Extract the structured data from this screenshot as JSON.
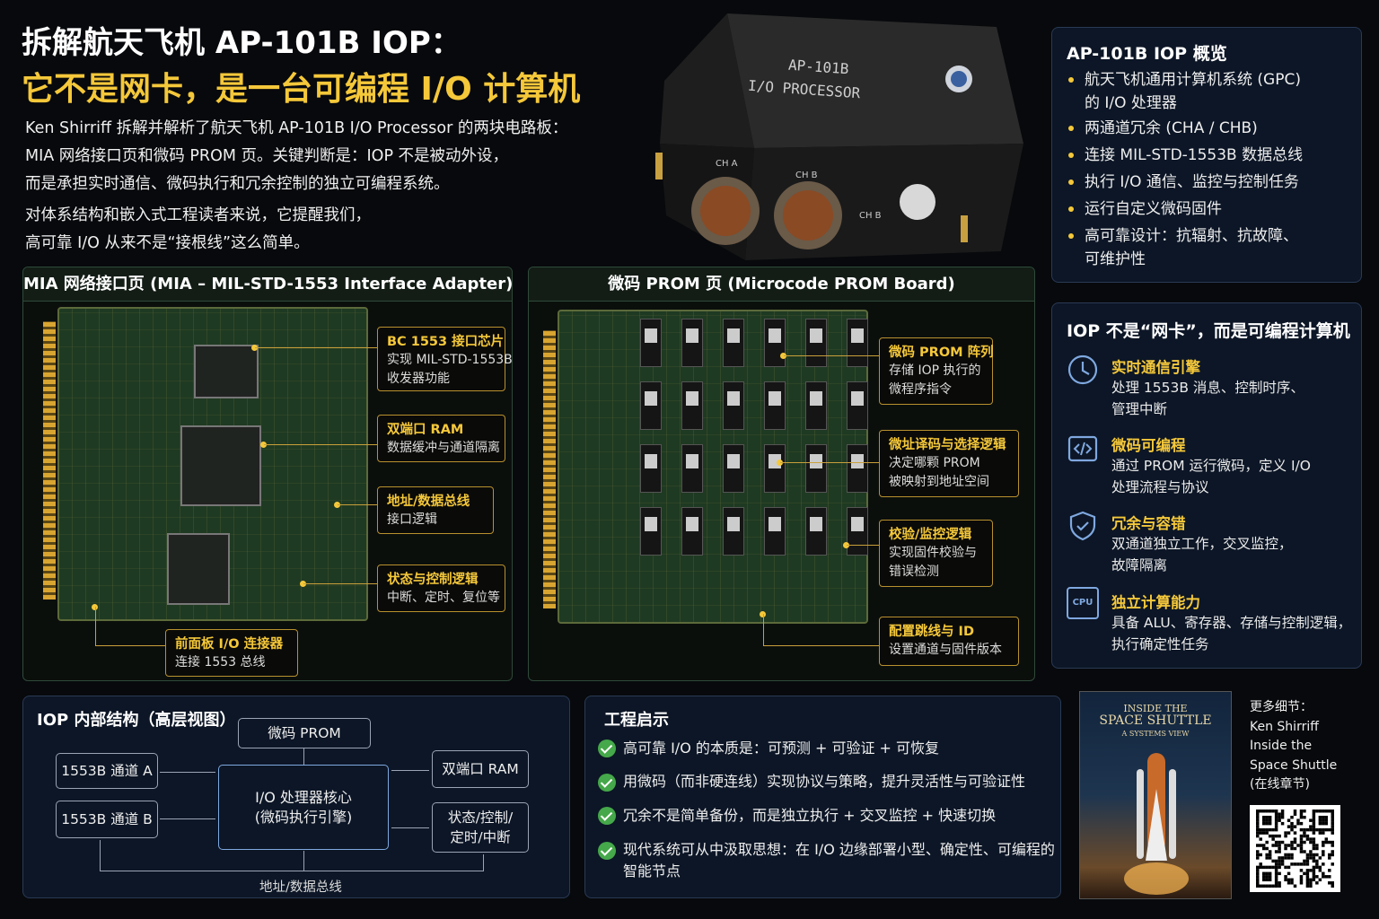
{
  "header": {
    "title_line1": "拆解航天飞机 AP-101B IOP：",
    "title_line2": "它不是网卡，是一台可编程 I/O 计算机",
    "intro": [
      "Ken Shirriff 拆解并解析了航天飞机 AP-101B I/O Processor 的两块电路板：",
      "MIA 网络接口页和微码 PROM 页。关键判断是：IOP 不是被动外设，",
      "而是承担实时通信、微码执行和冗余控制的独立可编程系统。",
      "对体系结构和嵌入式工程读者来说，它提醒我们，",
      "高可靠 I/O 从来不是“接根线”这么简单。"
    ]
  },
  "device": {
    "label_line1": "AP-101B",
    "label_line2": "I/O PROCESSOR",
    "ch_a": "CH A",
    "ch_b": "CH B",
    "ch_b_side": "CH B"
  },
  "overview": {
    "title": "AP-101B IOP 概览",
    "items": [
      [
        "航天飞机通用计算机系统 (GPC)",
        "的 I/O 处理器"
      ],
      [
        "两通道冗余 (CHA / CHB)"
      ],
      [
        "连接 MIL-STD-1553B 数据总线"
      ],
      [
        "执行 I/O 通信、监控与控制任务"
      ],
      [
        "运行自定义微码固件"
      ],
      [
        "高可靠设计：抗辐射、抗故障、",
        "可维护性"
      ]
    ]
  },
  "mia": {
    "title": "MIA 网络接口页 (MIA – MIL-STD-1553 Interface Adapter)",
    "callouts": [
      {
        "title": "BC 1553 接口芯片",
        "desc": [
          "实现 MIL-STD-1553B",
          "收发器功能"
        ]
      },
      {
        "title": "双端口 RAM",
        "desc": [
          "数据缓冲与通道隔离"
        ]
      },
      {
        "title": "地址/数据总线",
        "desc": [
          "接口逻辑"
        ]
      },
      {
        "title": "状态与控制逻辑",
        "desc": [
          "中断、定时、复位等"
        ]
      },
      {
        "title": "前面板 I/O 连接器",
        "desc": [
          "连接 1553 总线"
        ]
      }
    ]
  },
  "prom": {
    "title": "微码 PROM 页 (Microcode PROM Board)",
    "callouts": [
      {
        "title": "微码 PROM 阵列",
        "desc": [
          "存储 IOP 执行的",
          "微程序指令"
        ]
      },
      {
        "title": "微址译码与选择逻辑",
        "desc": [
          "决定哪颗 PROM",
          "被映射到地址空间"
        ]
      },
      {
        "title": "校验/监控逻辑",
        "desc": [
          "实现固件校验与",
          "错误检测"
        ]
      },
      {
        "title": "配置跳线与 ID",
        "desc": [
          "设置通道与固件版本"
        ]
      }
    ]
  },
  "features": {
    "title": "IOP 不是“网卡”，而是可编程计算机",
    "items": [
      {
        "icon": "clock-icon",
        "title": "实时通信引擎",
        "desc": [
          "处理 1553B 消息、控制时序、",
          "管理中断"
        ]
      },
      {
        "icon": "code-icon",
        "title": "微码可编程",
        "desc": [
          "通过 PROM 运行微码，定义 I/O",
          "处理流程与协议"
        ]
      },
      {
        "icon": "shield-icon",
        "title": "冗余与容错",
        "desc": [
          "双通道独立工作，交叉监控，",
          "故障隔离"
        ]
      },
      {
        "icon": "cpu-icon",
        "icon_text": "CPU",
        "title": "独立计算能力",
        "desc": [
          "具备 ALU、寄存器、存储与控制逻辑，",
          "执行确定性任务"
        ]
      }
    ]
  },
  "arch": {
    "title": "IOP 内部结构（高层视图）",
    "prom": "微码 PROM",
    "ch_a": "1553B 通道 A",
    "ch_b": "1553B 通道 B",
    "core1": "I/O 处理器核心",
    "core2": "(微码执行引擎)",
    "ram": "双端口 RAM",
    "ctl1": "状态/控制/",
    "ctl2": "定时/中断",
    "bus": "地址/数据总线"
  },
  "insights": {
    "title": "工程启示",
    "items": [
      [
        "高可靠 I/O 的本质是：可预测 + 可验证 + 可恢复"
      ],
      [
        "用微码（而非硬连线）实现协议与策略，提升灵活性与可验证性"
      ],
      [
        "冗余不是简单备份，而是独立执行 + 交叉监控 + 快速切换"
      ],
      [
        "现代系统可从中汲取思想：在 I/O 边缘部署小型、确定性、可编程的",
        "智能节点"
      ]
    ]
  },
  "book": {
    "line1": "INSIDE THE",
    "line2": "SPACE SHUTTLE",
    "line3": "A SYSTEMS VIEW"
  },
  "more": {
    "lines": [
      "更多细节：",
      "Ken Shirriff",
      "Inside the",
      "Space Shuttle",
      "(在线章节)"
    ]
  },
  "colors": {
    "accent": "#f5c83a",
    "check": "#45a84a",
    "panel_blue": "#0c1626",
    "pcb_green": "#1f3a22"
  }
}
